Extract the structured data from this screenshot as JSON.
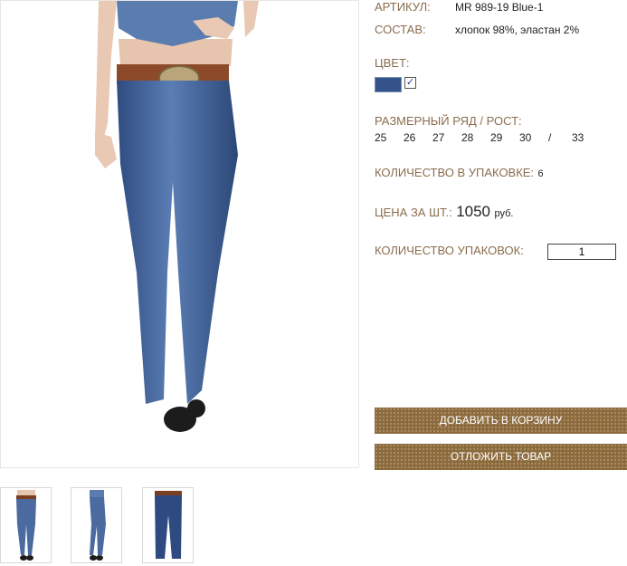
{
  "product": {
    "article_label": "АРТИКУЛ:",
    "article_value": "MR 989-19 Blue-1",
    "composition_label": "СОСТАВ:",
    "composition_value": "хлопок 98%, эластан 2%",
    "color_label": "ЦВЕТ:",
    "color_swatch": "#34538a",
    "color_checked": "✓",
    "sizes_label": "РАЗМЕРНЫЙ РЯД / РОСТ:",
    "sizes": [
      "25",
      "26",
      "27",
      "28",
      "29",
      "30",
      "/",
      "33"
    ],
    "pack_qty_label": "КОЛИЧЕСТВО В УПАКОВКЕ:",
    "pack_qty_value": "6",
    "price_label": "ЦЕНА ЗА ШТ.:",
    "price_value": "1050",
    "price_unit": "руб.",
    "packs_label": "КОЛИЧЕСТВО УПАКОВОК:",
    "packs_value": "1"
  },
  "buttons": {
    "add_to_cart": "ДОБАВИТЬ В КОРЗИНУ",
    "postpone": "ОТЛОЖИТЬ ТОВАР"
  },
  "colors": {
    "label": "#8a6d4e",
    "button": "#8b6a3e",
    "denim": "#3f5f95"
  }
}
